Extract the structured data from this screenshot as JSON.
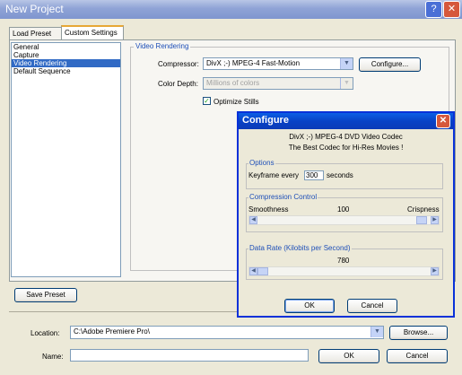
{
  "window": {
    "title": "New Project",
    "help_icon": "help-icon",
    "close_icon": "close-icon"
  },
  "tabs": [
    {
      "label": "Load Preset"
    },
    {
      "label": "Custom Settings"
    }
  ],
  "sidebar": {
    "items": [
      {
        "label": "General"
      },
      {
        "label": "Capture"
      },
      {
        "label": "Video Rendering"
      },
      {
        "label": "Default Sequence"
      }
    ],
    "selected_index": 2
  },
  "video_rendering": {
    "group_label": "Video Rendering",
    "compressor_label": "Compressor:",
    "compressor_value": "DivX ;-) MPEG-4 Fast-Motion",
    "configure_button": "Configure...",
    "color_depth_label": "Color Depth:",
    "color_depth_value": "Millions of colors",
    "optimize_stills_label": "Optimize Stills",
    "optimize_stills_checked": true
  },
  "save_preset_button": "Save Preset",
  "location": {
    "label": "Location:",
    "value": "C:\\Adobe Premiere Pro\\",
    "browse_button": "Browse..."
  },
  "name": {
    "label": "Name:",
    "value": ""
  },
  "footer": {
    "ok_button": "OK",
    "cancel_button": "Cancel"
  },
  "configure_dialog": {
    "title": "Configure",
    "codec_line1": "DivX ;-) MPEG-4 DVD Video Codec",
    "codec_line2": "The Best Codec for Hi-Res Movies !",
    "options": {
      "group_label": "Options",
      "keyframe_label": "Keyframe every",
      "keyframe_value": "300",
      "keyframe_unit": "seconds"
    },
    "compression": {
      "group_label": "Compression Control",
      "left_label": "Smoothness",
      "value": "100",
      "right_label": "Crispness",
      "slider_fraction": 0.98
    },
    "data_rate": {
      "group_label": "Data Rate (Kilobits per Second)",
      "value": "780",
      "slider_fraction": 0.0
    },
    "ok_button": "OK",
    "cancel_button": "Cancel"
  }
}
